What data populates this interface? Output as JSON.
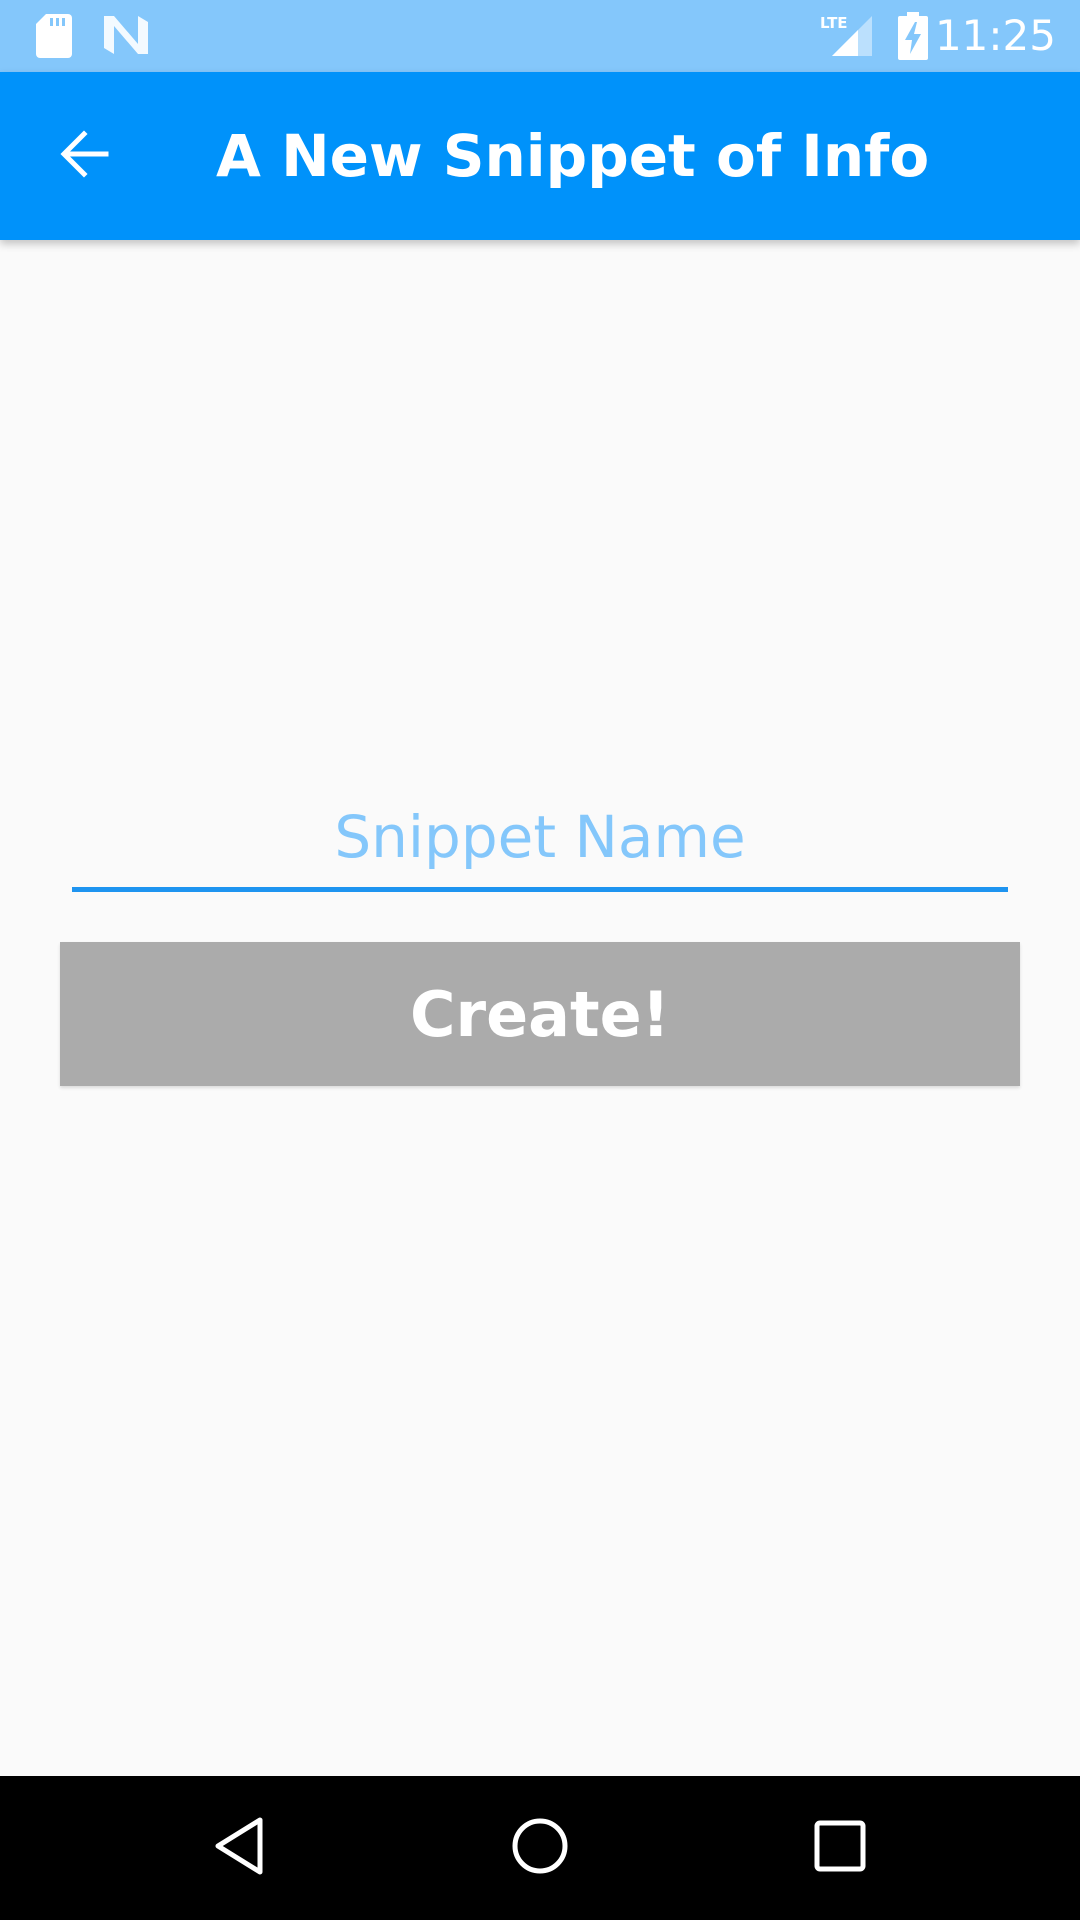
{
  "status_bar": {
    "time": "11:25",
    "icons": [
      "sd-card-icon",
      "n-notification-icon",
      "lte-signal-icon",
      "battery-charging-icon"
    ]
  },
  "app_bar": {
    "title": "A New Snippet of Info",
    "back_icon": "arrow-left-icon"
  },
  "form": {
    "name_field": {
      "placeholder": "Snippet Name",
      "value": ""
    },
    "create_label": "Create!"
  },
  "nav_bar": {
    "icons": [
      "back-triangle-icon",
      "home-circle-icon",
      "recents-square-icon"
    ]
  },
  "colors": {
    "status_bar": "#84c7fb",
    "app_bar": "#0092fa",
    "field_underline": "#1e94f0",
    "placeholder": "#84c7fb",
    "button": "#ababab",
    "background": "#fafafa",
    "nav_bar": "#000000"
  }
}
